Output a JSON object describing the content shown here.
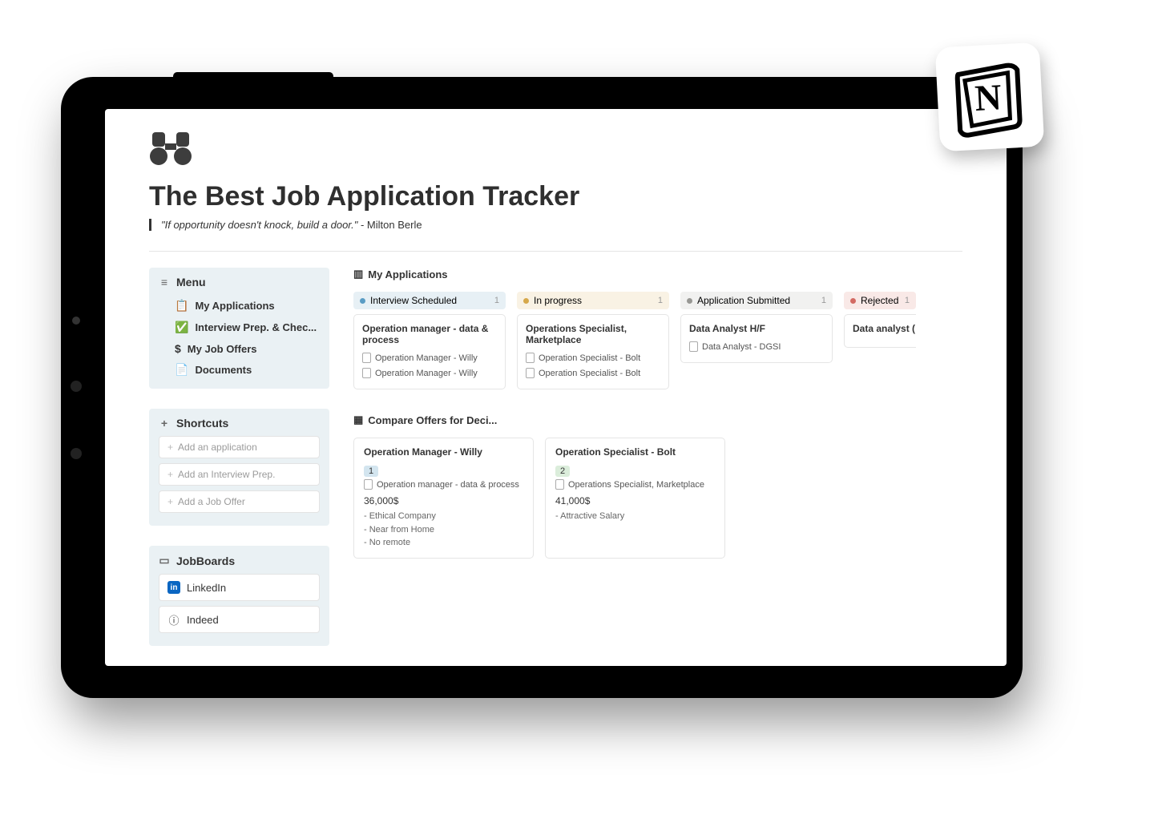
{
  "header": {
    "icon": "🔭",
    "title": "The Best Job Application Tracker",
    "quote_text": "\"If opportunity doesn't knock, build a door.\"",
    "quote_author": " - Milton Berle"
  },
  "sidebar": {
    "menu_label": "Menu",
    "menu_items": [
      {
        "icon": "📋",
        "label": "My Applications"
      },
      {
        "icon": "✅",
        "label": "Interview Prep. & Chec..."
      },
      {
        "icon": "$",
        "label": "My Job Offers"
      },
      {
        "icon": "📄",
        "label": "Documents"
      }
    ],
    "shortcuts_label": "Shortcuts",
    "shortcuts": [
      "Add an application",
      "Add an Interview Prep.",
      "Add a Job Offer"
    ],
    "jobboards_label": "JobBoards",
    "jobboards": [
      {
        "icon": "in",
        "label": "LinkedIn"
      },
      {
        "icon": "ⓘ",
        "label": "Indeed"
      }
    ]
  },
  "main": {
    "applications_title": "My Applications",
    "columns": [
      {
        "header": "Interview Scheduled",
        "count": "1",
        "color": "blue",
        "card_title": "Operation manager - data & process",
        "docs": [
          "Operation Manager - Willy",
          "Operation Manager - Willy"
        ]
      },
      {
        "header": "In progress",
        "count": "1",
        "color": "yellow",
        "card_title": "Operations Specialist, Marketplace",
        "docs": [
          "Operation Specialist - Bolt",
          "Operation Specialist - Bolt"
        ]
      },
      {
        "header": "Application Submitted",
        "count": "1",
        "color": "gray",
        "card_title": "Data Analyst H/F",
        "docs": [
          "Data Analyst - DGSI"
        ]
      },
      {
        "header": "Rejected",
        "count": "1",
        "color": "red",
        "card_title": "Data analyst (",
        "docs": []
      }
    ],
    "compare_title": "Compare Offers for Deci...",
    "compare": [
      {
        "title": "Operation Manager - Willy",
        "badge": "1",
        "badge_color": "blue",
        "doc": "Operation manager - data & process",
        "salary": "36,000$",
        "notes": [
          "- Ethical Company",
          "- Near from Home",
          "- No remote"
        ]
      },
      {
        "title": "Operation Specialist - Bolt",
        "badge": "2",
        "badge_color": "green",
        "doc": "Operations Specialist, Marketplace",
        "salary": "41,000$",
        "notes": [
          "- Attractive Salary"
        ]
      }
    ]
  }
}
